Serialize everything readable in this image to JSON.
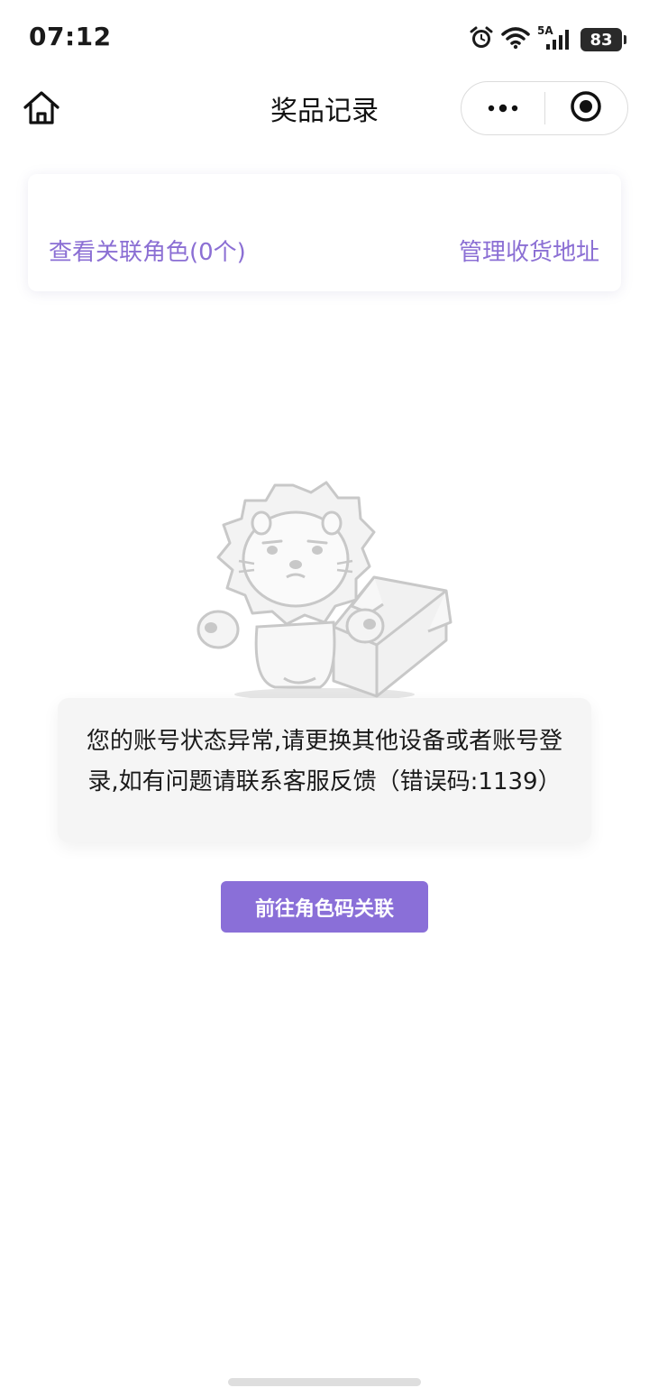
{
  "status_bar": {
    "time": "07:12",
    "network_label": "5A",
    "battery_level": "83",
    "icons": [
      "alarm-icon",
      "wifi-icon",
      "signal-icon",
      "battery-icon"
    ]
  },
  "nav": {
    "title": "奖品记录",
    "home_icon": "home-icon",
    "more_icon": "more-dots-icon",
    "close_icon": "target-circle-icon"
  },
  "card": {
    "left_link": "查看关联角色(0个)",
    "right_link": "管理收货地址"
  },
  "empty_state": {
    "illustration": "lion-with-box-illustration",
    "message": "您的账号状态异常,请更换其他设备或者账号登录,如有问题请联系客服反馈（错误码:1139）"
  },
  "action": {
    "button_label": "前往角色码关联"
  },
  "colors": {
    "accent": "#8a6fd8",
    "link": "#8b6fd4",
    "error_bg": "#f5f5f5"
  }
}
